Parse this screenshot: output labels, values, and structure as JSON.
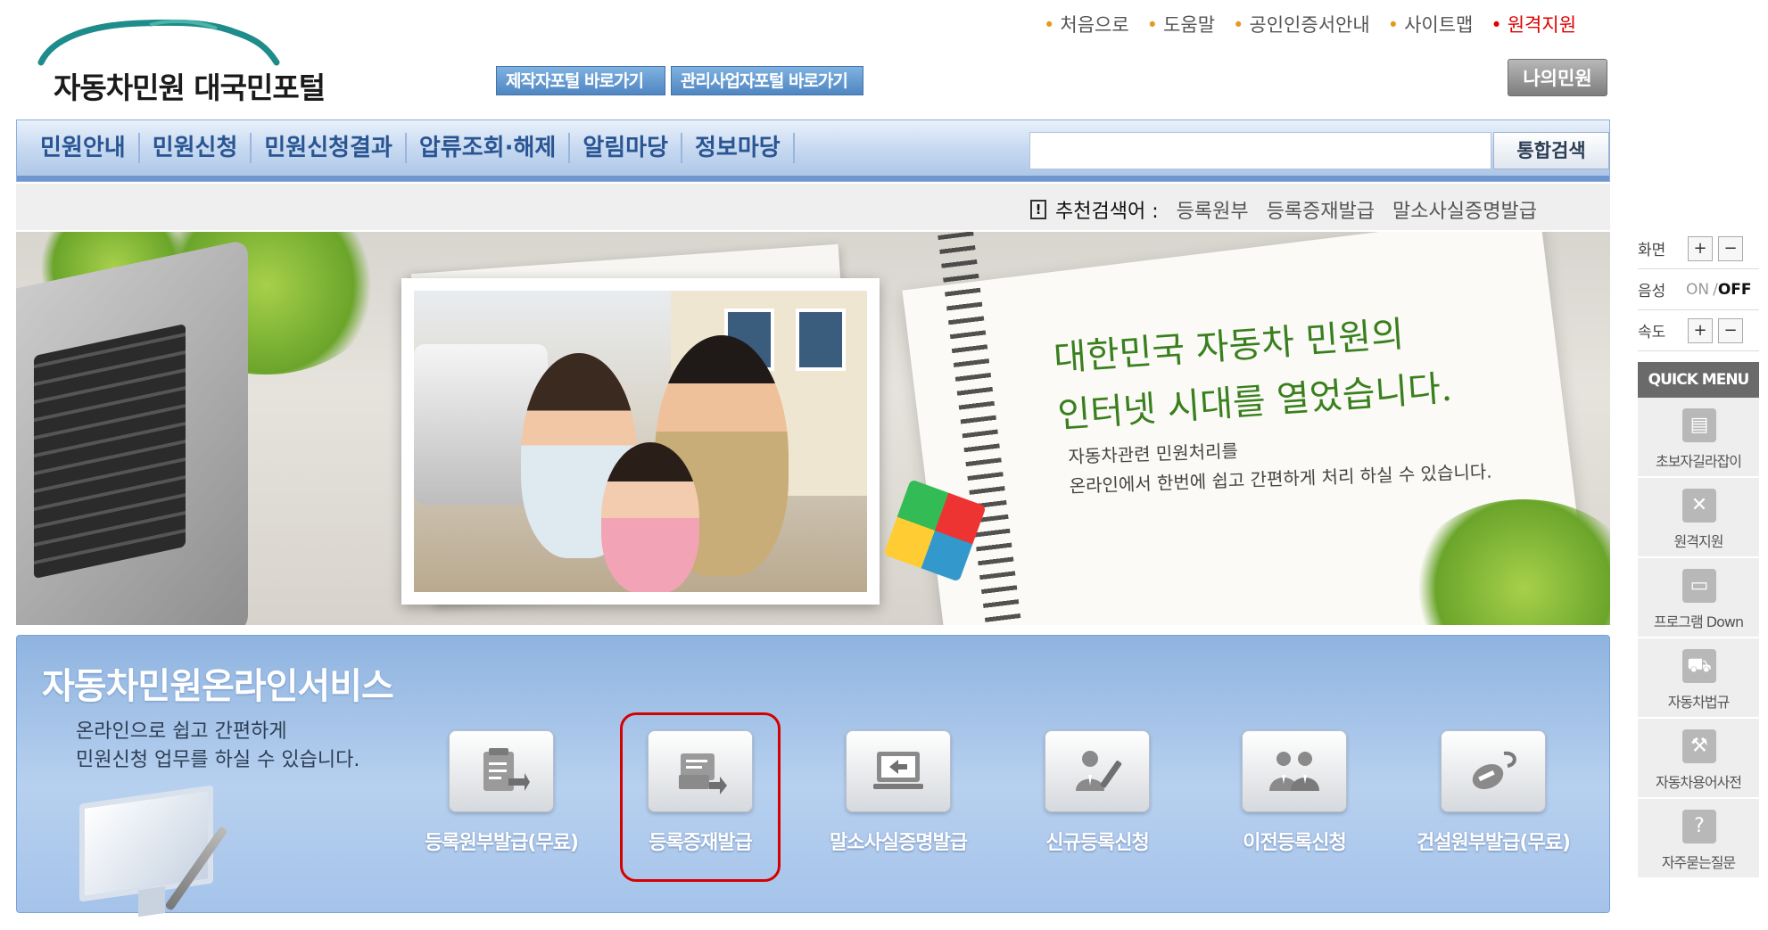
{
  "header": {
    "logo_text": "자동차민원 대국민포털",
    "portal_buttons": [
      "제작자포털 바로가기",
      "관리사업자포털 바로가기"
    ],
    "top_links": [
      "처음으로",
      "도움말",
      "공인인증서안내",
      "사이트맵",
      "원격지원"
    ],
    "my_button": "나의민원"
  },
  "nav": {
    "menu": [
      "민원안내",
      "민원신청",
      "민원신청결과",
      "압류조회·해제",
      "알림마당",
      "정보마당"
    ],
    "search_value": "",
    "search_button": "통합검색"
  },
  "recommended": {
    "label": "추천검색어 :",
    "keywords": [
      "등록원부",
      "등록증재발급",
      "말소사실증명발급"
    ]
  },
  "banner": {
    "slogan_line1": "대한민국 자동차 민원의",
    "slogan_line2": "인터넷 시대를 열었습니다.",
    "sub_line1": "자동차관련 민원처리를",
    "sub_line2": "온라인에서 한번에 쉽고 간편하게 처리 하실 수 있습니다."
  },
  "services": {
    "title": "자동차민원온라인서비스",
    "subtitle_line1": "온라인으로 쉽고 간편하게",
    "subtitle_line2": "민원신청 업무를 하실 수 있습니다.",
    "items": [
      {
        "label": "등록원부발급(무료)",
        "icon": "document-clipboard-icon"
      },
      {
        "label": "등록증재발급",
        "icon": "reissue-card-icon"
      },
      {
        "label": "말소사실증명발급",
        "icon": "computer-arrow-icon"
      },
      {
        "label": "신규등록신청",
        "icon": "person-pen-icon"
      },
      {
        "label": "이전등록신청",
        "icon": "two-persons-icon"
      },
      {
        "label": "건설원부발급(무료)",
        "icon": "construction-icon"
      }
    ],
    "highlight_color": "#d60000"
  },
  "sidebar": {
    "screen_label": "화면",
    "voice_label": "음성",
    "voice_on": "ON",
    "voice_sep": "/",
    "voice_off": "OFF",
    "speed_label": "속도",
    "plus": "+",
    "minus": "−",
    "quick_menu_title": "QUICK MENU",
    "quick_items": [
      {
        "label": "초보자길라잡이",
        "icon": "document-icon"
      },
      {
        "label": "원격지원",
        "icon": "tools-icon"
      },
      {
        "label": "프로그램 Down",
        "icon": "monitor-icon"
      },
      {
        "label": "자동차법규",
        "icon": "car-icon"
      },
      {
        "label": "자동차용어사전",
        "icon": "wrench-icon"
      },
      {
        "label": "자주묻는질문",
        "icon": "question-doc-icon"
      }
    ]
  },
  "colors": {
    "nav_text": "#2a5593",
    "accent_red": "#e00000",
    "service_bg": "#a5c3ea"
  }
}
